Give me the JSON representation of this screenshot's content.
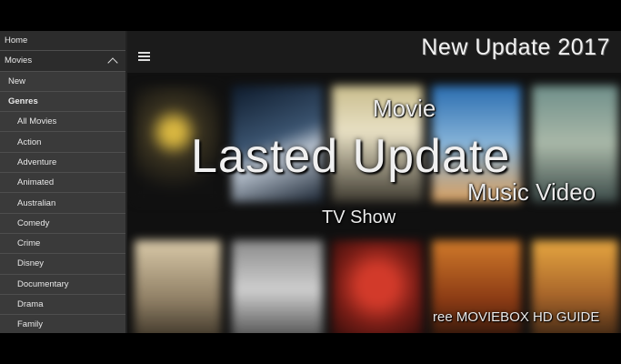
{
  "sidebar": {
    "items": [
      {
        "label": "Home"
      },
      {
        "label": "Movies"
      },
      {
        "label": "New"
      },
      {
        "label": "Genres"
      },
      {
        "label": "All Movies"
      },
      {
        "label": "Action"
      },
      {
        "label": "Adventure"
      },
      {
        "label": "Animated"
      },
      {
        "label": "Australian"
      },
      {
        "label": "Comedy"
      },
      {
        "label": "Crime"
      },
      {
        "label": "Disney"
      },
      {
        "label": "Documentary"
      },
      {
        "label": "Drama"
      },
      {
        "label": "Family"
      }
    ]
  },
  "header": {
    "menu_icon": "hamburger-icon",
    "title": "New Update 2017"
  },
  "overlay": {
    "movie": "Movie",
    "lasted_update": "Lasted Update",
    "music_video": "Music Video",
    "tv_show": "TV Show",
    "guide": "ree MOVIEBOX HD GUIDE"
  },
  "colors": {
    "sidebar_bg": "#3a3a3a",
    "topbar_bg": "#1b1b1b",
    "page_bg": "#000000"
  }
}
